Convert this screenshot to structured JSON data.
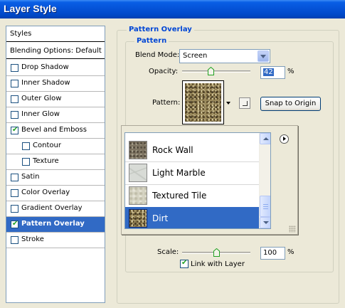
{
  "window": {
    "title": "Layer Style"
  },
  "styles_panel": {
    "header": "Styles",
    "blending": "Blending Options: Default",
    "items": [
      {
        "label": "Drop Shadow",
        "checked": false,
        "indent": false,
        "selected": false
      },
      {
        "label": "Inner Shadow",
        "checked": false,
        "indent": false,
        "selected": false
      },
      {
        "label": "Outer Glow",
        "checked": false,
        "indent": false,
        "selected": false
      },
      {
        "label": "Inner Glow",
        "checked": false,
        "indent": false,
        "selected": false
      },
      {
        "label": "Bevel and Emboss",
        "checked": true,
        "indent": false,
        "selected": false
      },
      {
        "label": "Contour",
        "checked": false,
        "indent": true,
        "selected": false
      },
      {
        "label": "Texture",
        "checked": false,
        "indent": true,
        "selected": false
      },
      {
        "label": "Satin",
        "checked": false,
        "indent": false,
        "selected": false
      },
      {
        "label": "Color Overlay",
        "checked": false,
        "indent": false,
        "selected": false
      },
      {
        "label": "Gradient Overlay",
        "checked": false,
        "indent": false,
        "selected": false
      },
      {
        "label": "Pattern Overlay",
        "checked": true,
        "indent": false,
        "selected": true
      },
      {
        "label": "Stroke",
        "checked": false,
        "indent": false,
        "selected": false
      }
    ]
  },
  "pattern_overlay": {
    "group_title": "Pattern Overlay",
    "sub_title": "Pattern",
    "blend_mode_label": "Blend Mode:",
    "blend_mode_value": "Screen",
    "opacity_label": "Opacity:",
    "opacity_value": "42",
    "opacity_level": 0.42,
    "opacity_unit": "%",
    "pattern_label": "Pattern:",
    "snap_button": "Snap to Origin",
    "scale_label": "Scale:",
    "scale_value": "100",
    "scale_level": 0.5,
    "scale_unit": "%",
    "link_label": "Link with Layer",
    "link_checked": true
  },
  "pattern_picker": {
    "items": [
      {
        "label": "Rock Wall",
        "swatch": "rockwall",
        "selected": false
      },
      {
        "label": "Light Marble",
        "swatch": "marble",
        "selected": false
      },
      {
        "label": "Textured Tile",
        "swatch": "tile",
        "selected": false
      },
      {
        "label": "Dirt",
        "swatch": "dirt",
        "selected": true
      }
    ]
  },
  "colors": {
    "title_bar": "#0553d8",
    "selection": "#316ac5",
    "group_title": "#0046d5",
    "checkmark": "#21a121"
  }
}
